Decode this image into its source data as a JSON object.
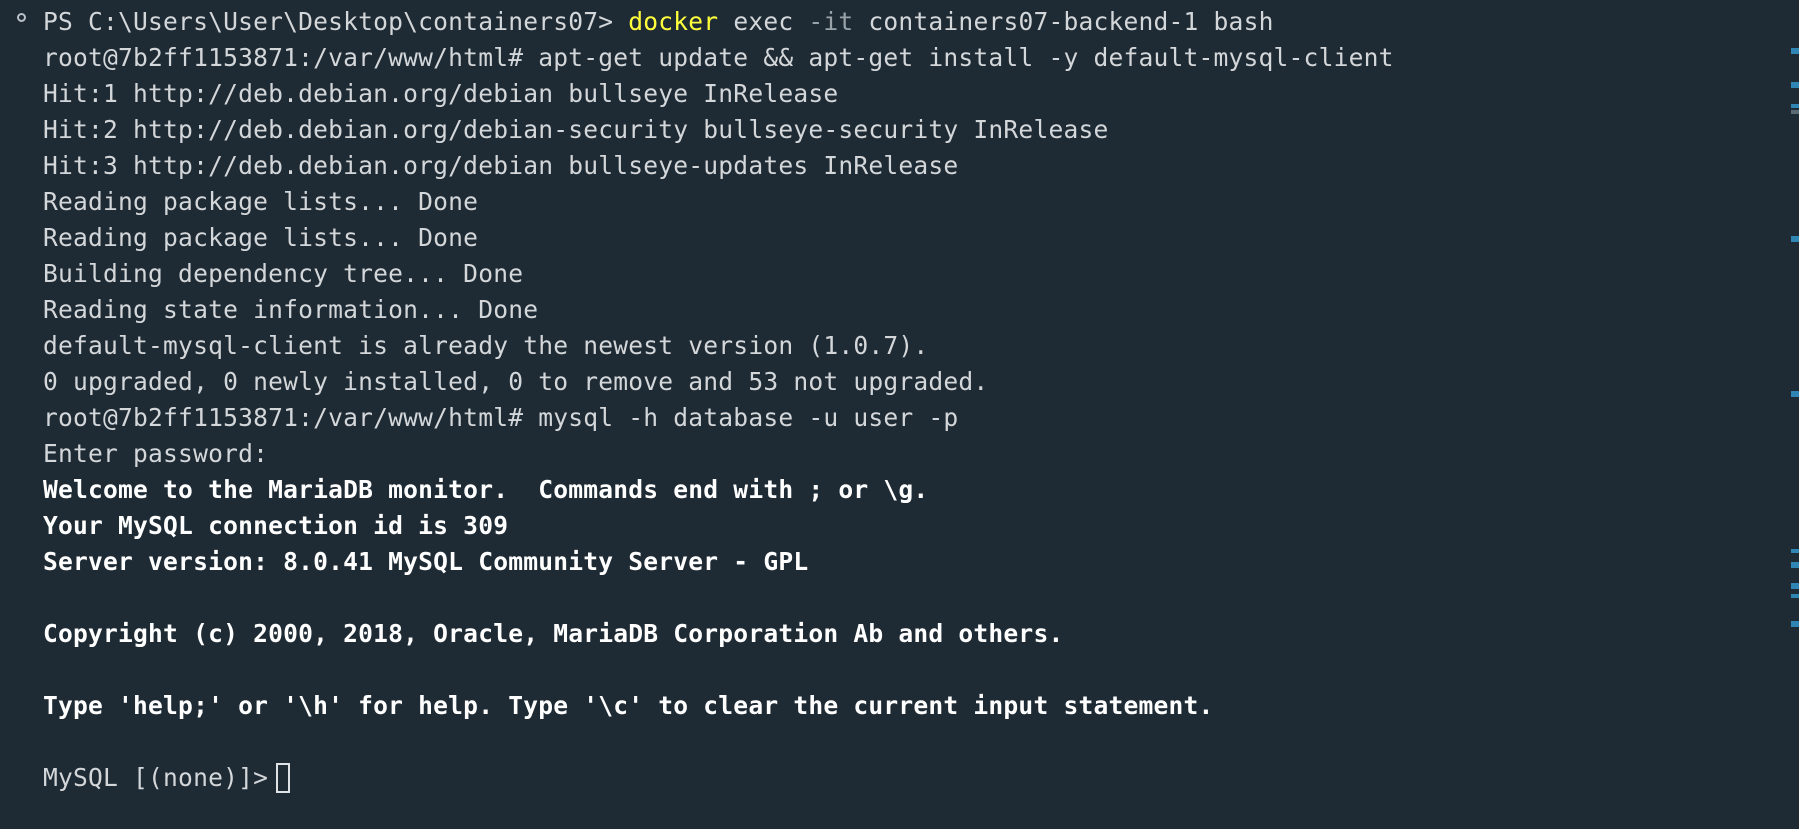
{
  "terminal": {
    "prompt_ps": "PS C:\\Users\\User\\Desktop\\containers07> ",
    "cmd_docker": "docker",
    "cmd_exec": " exec ",
    "cmd_flag": "-it",
    "cmd_rest": " containers07-backend-1 bash",
    "lines": [
      "root@7b2ff1153871:/var/www/html# apt-get update && apt-get install -y default-mysql-client",
      "Hit:1 http://deb.debian.org/debian bullseye InRelease",
      "Hit:2 http://deb.debian.org/debian-security bullseye-security InRelease",
      "Hit:3 http://deb.debian.org/debian bullseye-updates InRelease",
      "Reading package lists... Done",
      "Reading package lists... Done",
      "Building dependency tree... Done",
      "Reading state information... Done",
      "default-mysql-client is already the newest version (1.0.7).",
      "0 upgraded, 0 newly installed, 0 to remove and 53 not upgraded.",
      "root@7b2ff1153871:/var/www/html# mysql -h database -u user -p",
      "Enter password:"
    ],
    "bold_lines": [
      "Welcome to the MariaDB monitor.  Commands end with ; or \\g.",
      "Your MySQL connection id is 309",
      "Server version: 8.0.41 MySQL Community Server - GPL",
      "",
      "Copyright (c) 2000, 2018, Oracle, MariaDB Corporation Ab and others.",
      "",
      "Type 'help;' or '\\h' for help. Type '\\c' to clear the current input statement.",
      ""
    ],
    "mysql_prompt": "MySQL [(none)]>"
  },
  "colors": {
    "background": "#1e2b34",
    "text": "#d4d7da",
    "docker_command": "#ffff3c",
    "flag": "#9aa3aa",
    "scroll_marker": "#2f86b4"
  }
}
